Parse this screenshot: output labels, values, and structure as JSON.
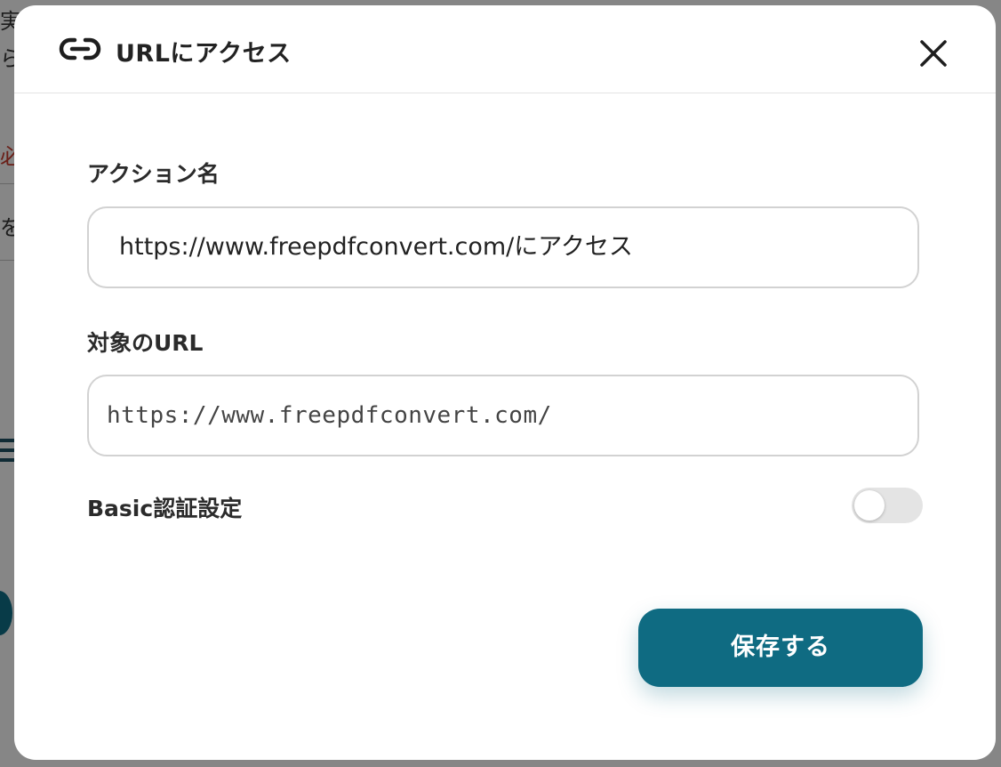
{
  "background": {
    "partial_texts": [
      "実",
      "ら",
      "必",
      "を"
    ]
  },
  "modal": {
    "title": "URLにアクセス",
    "icon": "link-icon",
    "close_icon": "close-icon",
    "action_name": {
      "label": "アクション名",
      "value": "https://www.freepdfconvert.com/にアクセス"
    },
    "target_url": {
      "label": "対象のURL",
      "value": "https://www.freepdfconvert.com/"
    },
    "basic_auth": {
      "label": "Basic認証設定",
      "enabled": false
    },
    "save_label": "保存する"
  },
  "colors": {
    "accent": "#0f6b82",
    "overlay": "#6f6f6f",
    "toggle_off": "#e4e4e4"
  }
}
